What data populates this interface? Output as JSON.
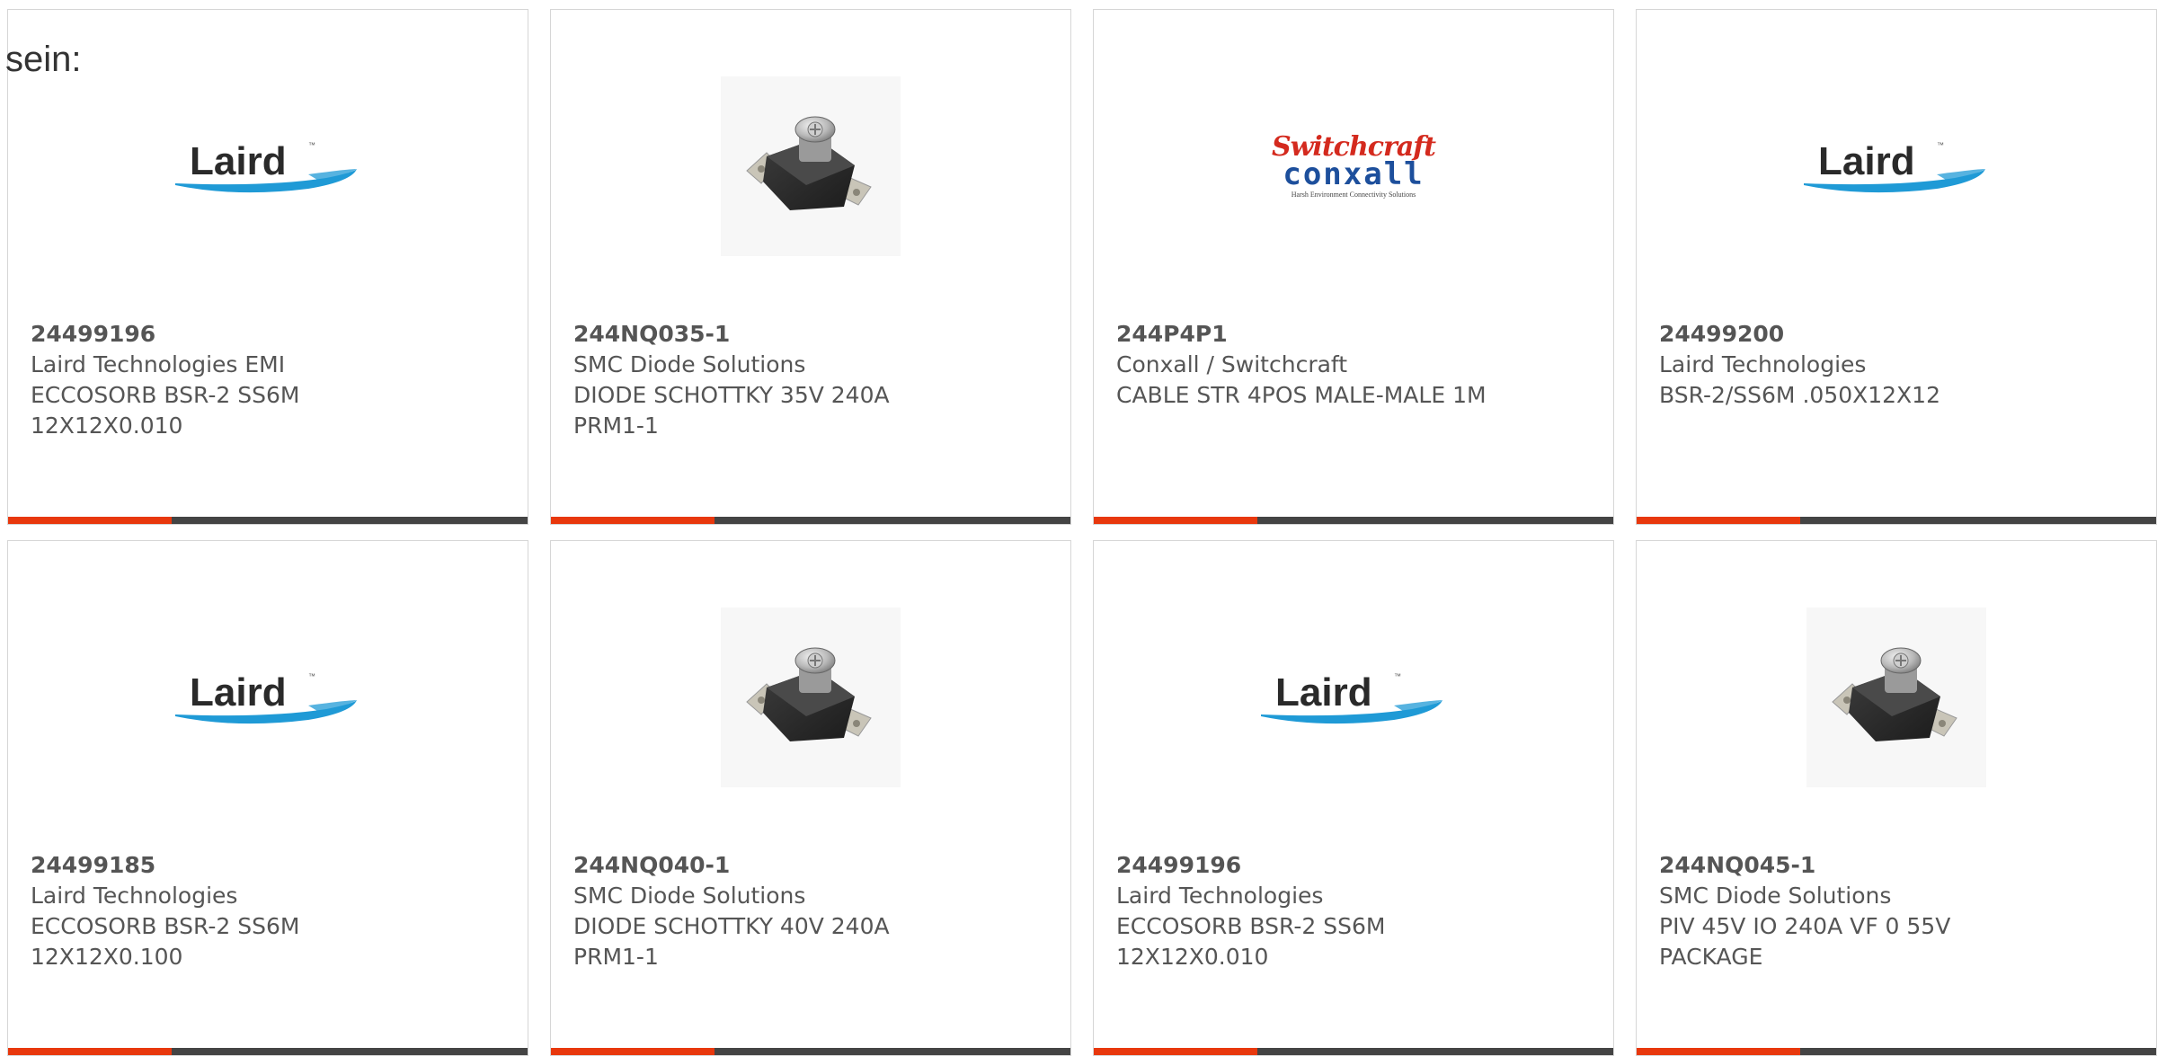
{
  "intro_text": "sein:",
  "theme": {
    "accent": "#e8380d",
    "bar": "#444444",
    "laird_blue": "#1f9ad6",
    "conxall_red": "#d42a1e",
    "conxall_blue": "#1d4f9c"
  },
  "products": [
    {
      "part_number": "24499196",
      "manufacturer": "Laird Technologies EMI",
      "desc1": "ECCOSORB BSR-2 SS6M",
      "desc2": "12X12X0.010",
      "image": "laird-logo",
      "logo_text": "Laird"
    },
    {
      "part_number": "244NQ035-1",
      "manufacturer": "SMC Diode Solutions",
      "desc1": "DIODE SCHOTTKY 35V 240A",
      "desc2": "PRM1-1",
      "image": "diode-module-photo"
    },
    {
      "part_number": "244P4P1",
      "manufacturer": "Conxall / Switchcraft",
      "desc1": "CABLE STR 4POS MALE-MALE 1M",
      "desc2": "",
      "image": "switchcraft-conxall-logo",
      "logo_top": "Switchcraft",
      "logo_mid": "conxall",
      "logo_tag": "Harsh Environment Connectivity Solutions"
    },
    {
      "part_number": "24499200",
      "manufacturer": "Laird Technologies",
      "desc1": "BSR-2/SS6M .050X12X12",
      "desc2": "",
      "image": "laird-logo",
      "logo_text": "Laird"
    },
    {
      "part_number": "24499185",
      "manufacturer": "Laird Technologies",
      "desc1": "ECCOSORB BSR-2 SS6M",
      "desc2": "12X12X0.100",
      "image": "laird-logo",
      "logo_text": "Laird"
    },
    {
      "part_number": "244NQ040-1",
      "manufacturer": "SMC Diode Solutions",
      "desc1": "DIODE SCHOTTKY 40V 240A",
      "desc2": "PRM1-1",
      "image": "diode-module-photo"
    },
    {
      "part_number": "24499196",
      "manufacturer": "Laird Technologies",
      "desc1": "ECCOSORB BSR-2 SS6M",
      "desc2": "12X12X0.010",
      "image": "laird-logo",
      "logo_text": "Laird"
    },
    {
      "part_number": "244NQ045-1",
      "manufacturer": "SMC Diode Solutions",
      "desc1": "PIV 45V IO 240A VF 0 55V",
      "desc2": "PACKAGE",
      "image": "diode-module-photo"
    }
  ]
}
